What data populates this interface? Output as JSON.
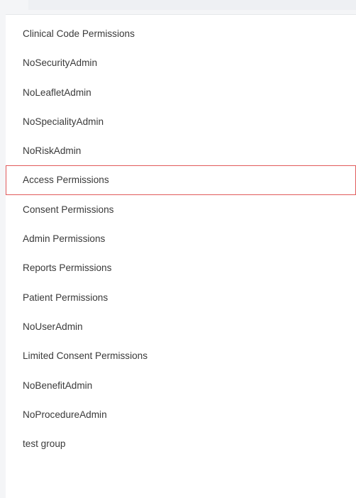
{
  "permission_groups": {
    "items": [
      {
        "label": "Clinical Code Permissions",
        "selected": false
      },
      {
        "label": "NoSecurityAdmin",
        "selected": false
      },
      {
        "label": "NoLeafletAdmin",
        "selected": false
      },
      {
        "label": "NoSpecialityAdmin",
        "selected": false
      },
      {
        "label": "NoRiskAdmin",
        "selected": false
      },
      {
        "label": "Access Permissions",
        "selected": true
      },
      {
        "label": "Consent Permissions",
        "selected": false
      },
      {
        "label": "Admin Permissions",
        "selected": false
      },
      {
        "label": "Reports Permissions",
        "selected": false
      },
      {
        "label": "Patient Permissions",
        "selected": false
      },
      {
        "label": "NoUserAdmin",
        "selected": false
      },
      {
        "label": "Limited Consent Permissions",
        "selected": false
      },
      {
        "label": "NoBenefitAdmin",
        "selected": false
      },
      {
        "label": "NoProcedureAdmin",
        "selected": false
      },
      {
        "label": "test group",
        "selected": false
      }
    ]
  },
  "colors": {
    "selected_border": "#e15b5b",
    "text": "#3a3a3a",
    "panel_background": "#ffffff",
    "page_background": "#f4f5f7"
  }
}
